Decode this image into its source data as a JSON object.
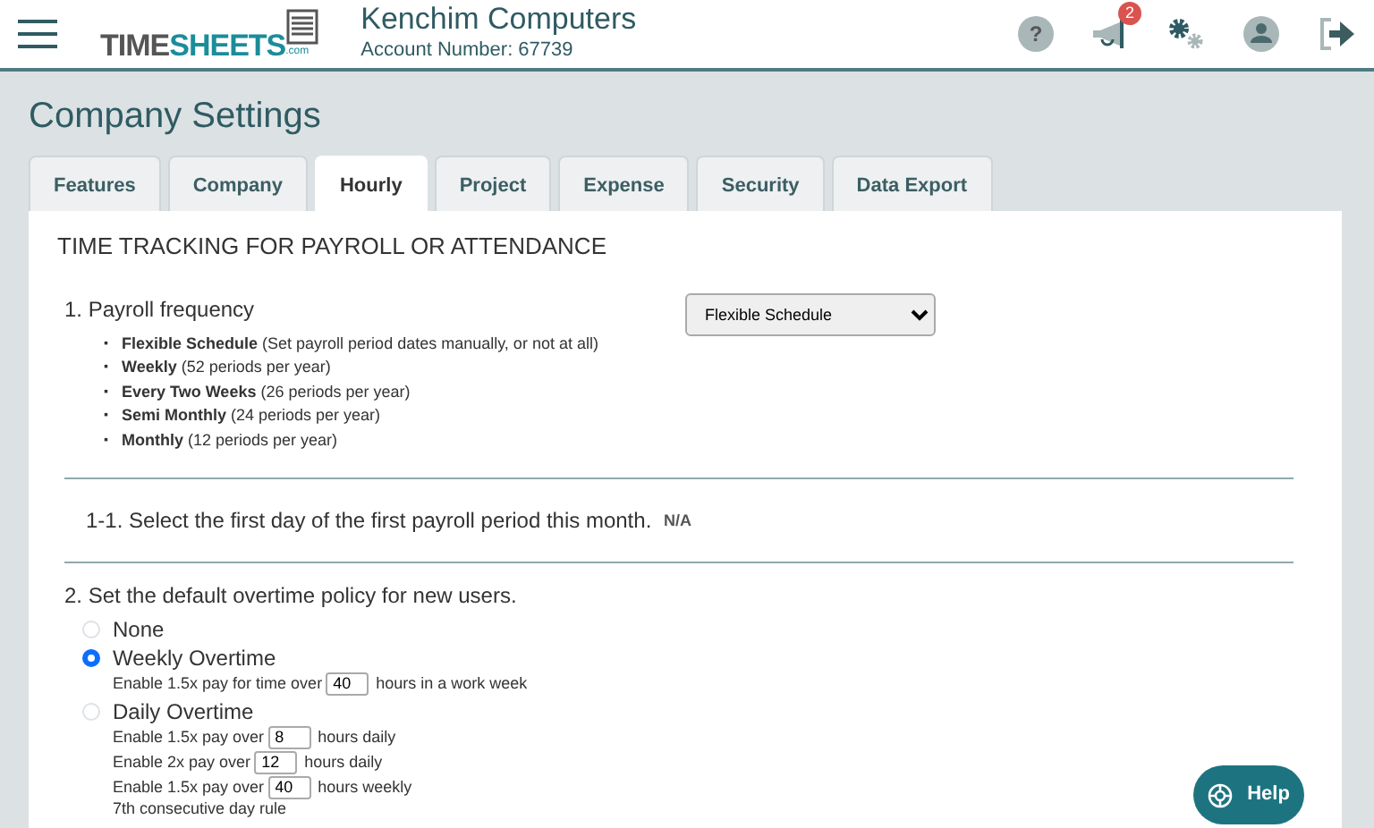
{
  "header": {
    "logo": {
      "dark": "TIME",
      "accent": "SHEETS",
      "suffix": ".com"
    },
    "company": "Kenchim Computers",
    "account": "Account Number: 67739",
    "notification_count": "2",
    "help_icon": "?"
  },
  "page_title": "Company Settings",
  "tabs": [
    {
      "label": "Features",
      "selected": false
    },
    {
      "label": "Company",
      "selected": false
    },
    {
      "label": "Hourly",
      "selected": true
    },
    {
      "label": "Project",
      "selected": false
    },
    {
      "label": "Expense",
      "selected": false
    },
    {
      "label": "Security",
      "selected": false
    },
    {
      "label": "Data Export",
      "selected": false
    }
  ],
  "panel": {
    "heading": "TIME TRACKING FOR PAYROLL OR ATTENDANCE",
    "payroll_frequency": {
      "label": "1. Payroll frequency",
      "bullet": "▪",
      "options": [
        "**Flexible Schedule** (Set payroll period dates manually, or not at all)",
        "**Weekly** (52 periods per year)",
        "**Every Two Weeks** (26 periods per year)",
        "**Semi Monthly** (24 periods per year)",
        "**Monthly** (12 periods per year)"
      ],
      "select_value": "Flexible Schedule"
    },
    "first_day": {
      "label": "1-1. Select the first day of the first payroll period this month.",
      "value": "N/A"
    },
    "overtime": {
      "label": "2. Set the default overtime policy for new users.",
      "options": [
        {
          "label": "None",
          "selected": false
        },
        {
          "label": "Weekly Overtime",
          "selected": true,
          "lines": [
            {
              "kind": "input",
              "before": "Enable 1.5x pay for time over",
              "value": "40",
              "after": "hours in a work week"
            }
          ]
        },
        {
          "label": "Daily Overtime",
          "selected": false,
          "lines": [
            {
              "kind": "input",
              "before": "Enable 1.5x pay over",
              "value": "8",
              "after": "hours daily"
            },
            {
              "kind": "input",
              "before": "Enable 2x pay over",
              "value": "12",
              "after": "hours daily"
            },
            {
              "kind": "input",
              "before": "Enable 1.5x pay over",
              "value": "40",
              "after": "hours weekly"
            },
            {
              "kind": "text",
              "text": "7th consecutive day rule"
            }
          ]
        }
      ]
    }
  },
  "help_button": "Help"
}
